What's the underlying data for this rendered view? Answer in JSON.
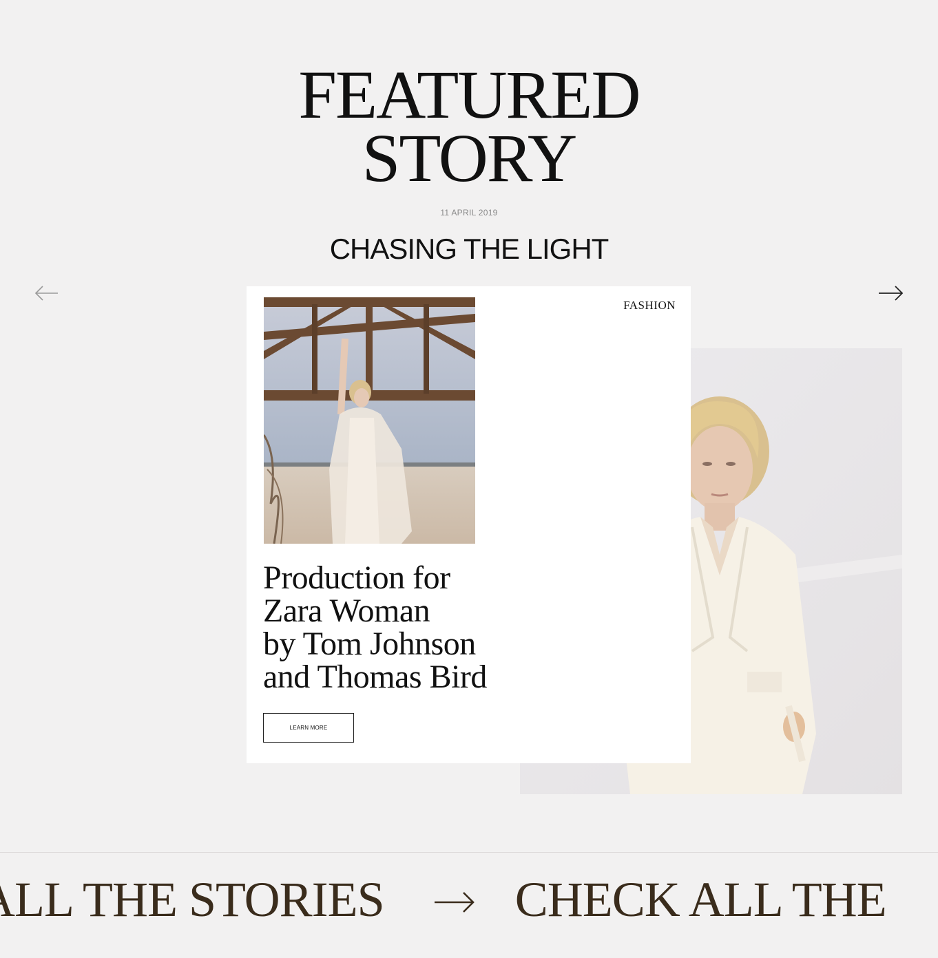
{
  "header": {
    "headline_line1": "FEATURED",
    "headline_line2": "STORY",
    "date": "11 APRIL 2019",
    "story_title": "CHASING THE LIGHT"
  },
  "carousel": {
    "prev_icon": "arrow-left-icon",
    "next_icon": "arrow-right-icon"
  },
  "card": {
    "category": "FASHION",
    "title_lines": [
      "Production for",
      "Zara Woman",
      "by Tom Johnson",
      "and Thomas Bird"
    ],
    "cta_label": "LEARN MORE"
  },
  "footer_marquee": {
    "segment1": "ALL THE STORIES",
    "segment2": "CHECK ALL THE",
    "arrow_icon": "arrow-right-icon"
  },
  "colors": {
    "background": "#f2f1f1",
    "card": "#ffffff",
    "marquee_text": "#3a2c1c"
  }
}
